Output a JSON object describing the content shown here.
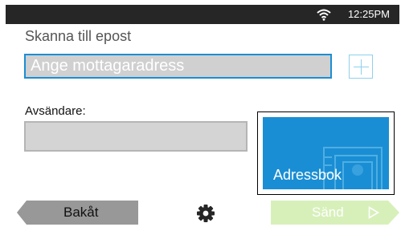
{
  "status_bar": {
    "time": "12:25PM",
    "wifi_icon": "wifi-icon"
  },
  "screen": {
    "title": "Skanna till epost"
  },
  "recipient": {
    "placeholder": "Ange mottagaradress",
    "add_icon": "plus-icon"
  },
  "sender": {
    "label": "Avsändare:",
    "value": ""
  },
  "address_book": {
    "label": "Adressbok"
  },
  "footer": {
    "back_label": "Bakåt",
    "settings_icon": "gear-icon",
    "send_label": "Sänd",
    "send_icon": "play-arrow-icon"
  },
  "colors": {
    "accent": "#1a8ed4",
    "status_bar": "#262626",
    "send_disabled": "#d7f0ba",
    "back_button": "#989898"
  }
}
